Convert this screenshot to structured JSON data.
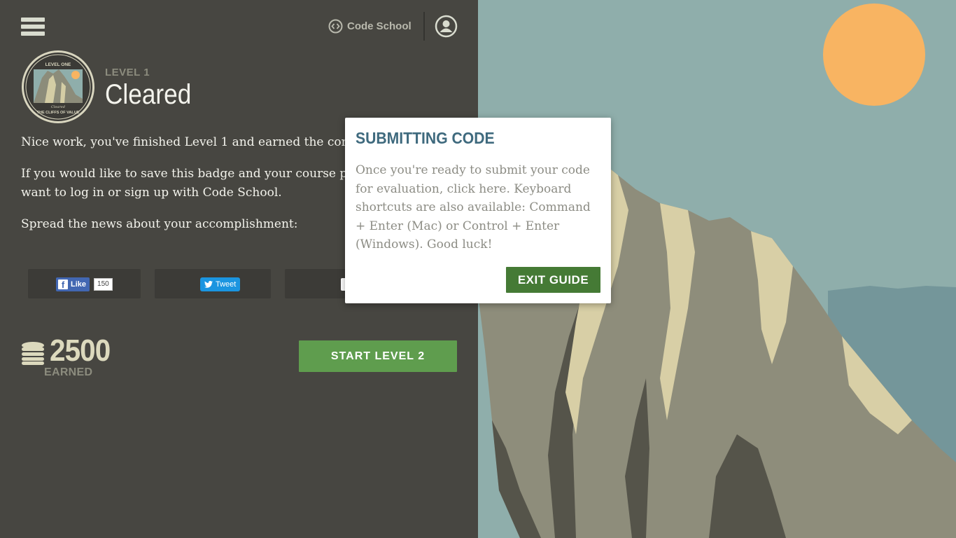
{
  "header": {
    "menu_icon": "hamburger-menu-icon",
    "brand_icon": "code-brackets-icon",
    "brand_name": "Code School",
    "user_icon": "user-avatar-icon"
  },
  "badge": {
    "top_text": "LEVEL ONE",
    "script_text": "Cleared",
    "bottom_text": "THE CLIFFS OF VALUE"
  },
  "level": {
    "kicker": "LEVEL 1",
    "title": "Cleared"
  },
  "messages": {
    "p1": "Nice work, you've finished Level 1 and earned the comp",
    "p2_line1": "If you would like to save this badge and your course pr",
    "p2_line2": "want to log in or sign up with Code School.",
    "p3": "Spread the news about your accomplishment:"
  },
  "share": {
    "facebook_label": "Like",
    "facebook_count": "150",
    "twitter_label": "Tweet"
  },
  "points": {
    "value": "2500",
    "label": "EARNED",
    "icon": "coin-stack-icon"
  },
  "start_button": "START LEVEL 2",
  "guide": {
    "title": "SUBMITTING CODE",
    "text": "Once you're ready to submit your code for evaluation, click here. Keyboard shortcuts are also available: Command + Enter (Mac) or Control + Enter (Windows). Good luck!",
    "exit_button": "EXIT GUIDE"
  },
  "colors": {
    "panel_bg": "#474641",
    "sky": "#8faeab",
    "sun": "#f8b462",
    "accent_green": "#5f9d4e",
    "guide_title": "#3f6a7e"
  }
}
